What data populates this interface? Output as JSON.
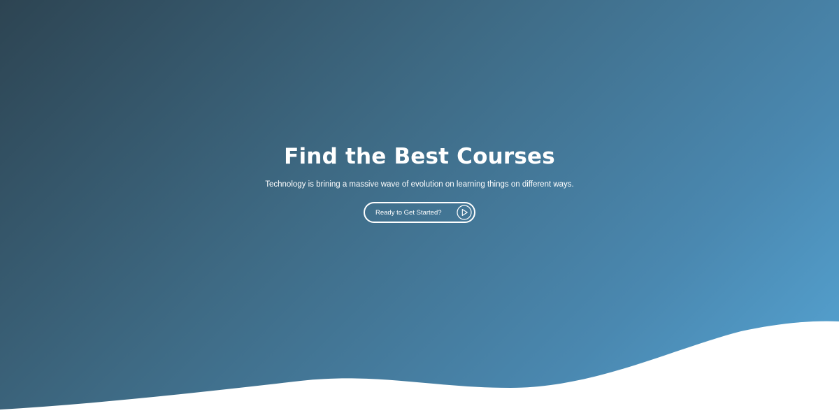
{
  "hero": {
    "title": "Find the Best Courses",
    "subtitle": "Technology is brining a massive wave of evolution on learning things on different ways.",
    "cta": {
      "label": "Ready to Get Started?",
      "icon": "play-circle-icon"
    }
  },
  "colors": {
    "gradient_start": "#2d4452",
    "gradient_end": "#56a6d6",
    "text": "#ffffff",
    "wave": "#ffffff"
  }
}
